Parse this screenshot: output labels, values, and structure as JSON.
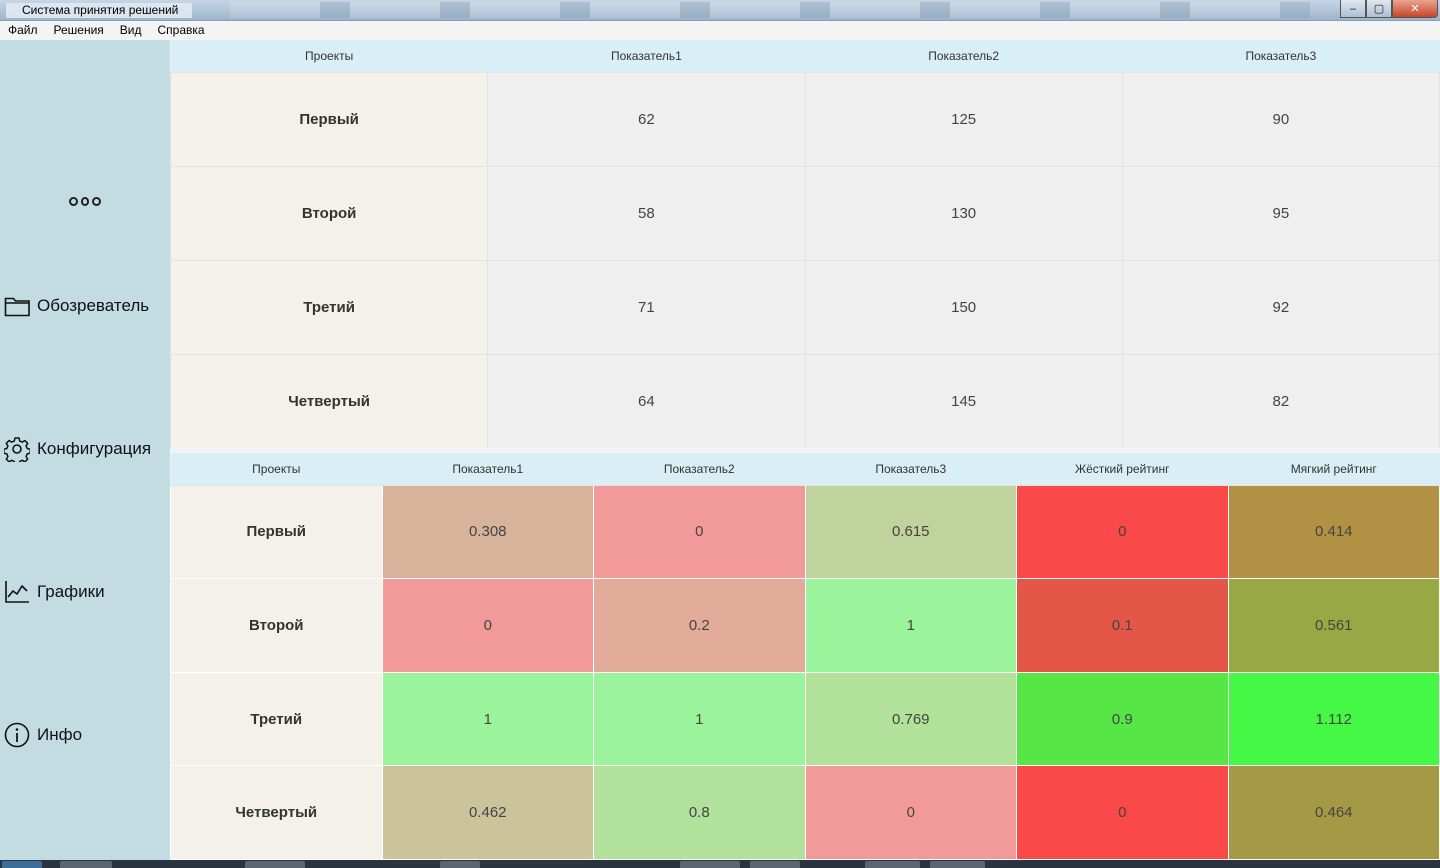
{
  "window": {
    "title": "Система принятия решений",
    "buttons": {
      "minimize": "‒",
      "maximize": "▢",
      "close": "✕"
    }
  },
  "menu": [
    "Файл",
    "Решения",
    "Вид",
    "Справка"
  ],
  "sidebar": {
    "more_icon": "ooo",
    "items": [
      {
        "label": "Обозреватель",
        "icon": "folder-icon"
      },
      {
        "label": "Конфигурация",
        "icon": "gear-icon"
      },
      {
        "label": "Графики",
        "icon": "chart-icon"
      },
      {
        "label": "Инфо",
        "icon": "info-icon"
      }
    ]
  },
  "raw_table": {
    "headers": [
      "Проекты",
      "Показатель1",
      "Показатель2",
      "Показатель3"
    ],
    "rows": [
      {
        "name": "Первый",
        "values": [
          "62",
          "125",
          "90"
        ]
      },
      {
        "name": "Второй",
        "values": [
          "58",
          "130",
          "95"
        ]
      },
      {
        "name": "Третий",
        "values": [
          "71",
          "150",
          "92"
        ]
      },
      {
        "name": "Четвертый",
        "values": [
          "64",
          "145",
          "82"
        ]
      }
    ]
  },
  "rating_table": {
    "headers": [
      "Проекты",
      "Показатель1",
      "Показатель2",
      "Показатель3",
      "Жёсткий рейтинг",
      "Мягкий рейтинг"
    ],
    "rows": [
      {
        "name": "Первый",
        "cells": [
          {
            "value": "0.308",
            "color": "#d6b39a"
          },
          {
            "value": "0",
            "color": "#f29a99"
          },
          {
            "value": "0.615",
            "color": "#c0d39c"
          },
          {
            "value": "0",
            "color": "#fb4848"
          },
          {
            "value": "0.414",
            "color": "#b19245"
          }
        ]
      },
      {
        "name": "Второй",
        "cells": [
          {
            "value": "0",
            "color": "#f29a99"
          },
          {
            "value": "0.2",
            "color": "#e1aa99"
          },
          {
            "value": "1",
            "color": "#9bf49b"
          },
          {
            "value": "0.1",
            "color": "#e45647"
          },
          {
            "value": "0.561",
            "color": "#97a845"
          }
        ]
      },
      {
        "name": "Третий",
        "cells": [
          {
            "value": "1",
            "color": "#9bf49b"
          },
          {
            "value": "1",
            "color": "#9bf49b"
          },
          {
            "value": "0.769",
            "color": "#b2e19a"
          },
          {
            "value": "0.9",
            "color": "#56e645"
          },
          {
            "value": "1.112",
            "color": "#45f845"
          }
        ]
      },
      {
        "name": "Четвертый",
        "cells": [
          {
            "value": "0.462",
            "color": "#cbc49b"
          },
          {
            "value": "0.8",
            "color": "#b1e19a"
          },
          {
            "value": "0",
            "color": "#f29a99"
          },
          {
            "value": "0",
            "color": "#fb4848"
          },
          {
            "value": "0.464",
            "color": "#a69945"
          }
        ]
      }
    ]
  }
}
